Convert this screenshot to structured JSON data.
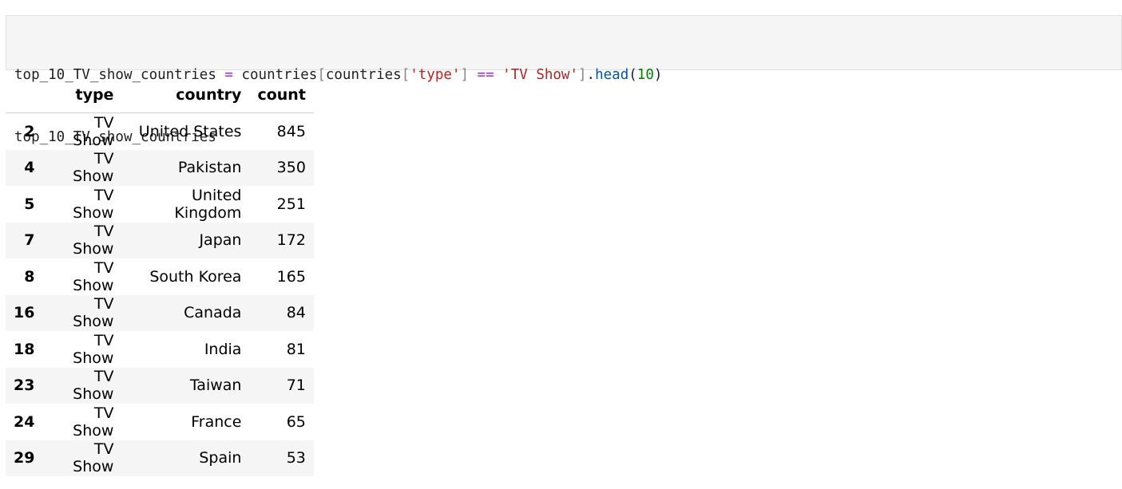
{
  "code_cell": {
    "line1": [
      {
        "t": "top_10_TV_show_countries ",
        "c": "var"
      },
      {
        "t": "=",
        "c": "op"
      },
      {
        "t": " countries",
        "c": "var"
      },
      {
        "t": "[",
        "c": "br"
      },
      {
        "t": "countries",
        "c": "var"
      },
      {
        "t": "[",
        "c": "br"
      },
      {
        "t": "'type'",
        "c": "str"
      },
      {
        "t": "]",
        "c": "br"
      },
      {
        "t": " ",
        "c": "p"
      },
      {
        "t": "==",
        "c": "op"
      },
      {
        "t": " ",
        "c": "p"
      },
      {
        "t": "'TV Show'",
        "c": "str"
      },
      {
        "t": "]",
        "c": "br"
      },
      {
        "t": ".",
        "c": "p"
      },
      {
        "t": "head",
        "c": "fn"
      },
      {
        "t": "(",
        "c": "p"
      },
      {
        "t": "10",
        "c": "num"
      },
      {
        "t": ")",
        "c": "p"
      }
    ],
    "line2": "top_10_TV_show_countries"
  },
  "dataframe": {
    "columns": [
      "",
      "type",
      "country",
      "count"
    ],
    "rows": [
      {
        "index": "2",
        "type": "TV Show",
        "country": "United States",
        "count": "845"
      },
      {
        "index": "4",
        "type": "TV Show",
        "country": "Pakistan",
        "count": "350"
      },
      {
        "index": "5",
        "type": "TV Show",
        "country": "United Kingdom",
        "count": "251"
      },
      {
        "index": "7",
        "type": "TV Show",
        "country": "Japan",
        "count": "172"
      },
      {
        "index": "8",
        "type": "TV Show",
        "country": "South Korea",
        "count": "165"
      },
      {
        "index": "16",
        "type": "TV Show",
        "country": "Canada",
        "count": "84"
      },
      {
        "index": "18",
        "type": "TV Show",
        "country": "India",
        "count": "81"
      },
      {
        "index": "23",
        "type": "TV Show",
        "country": "Taiwan",
        "count": "71"
      },
      {
        "index": "24",
        "type": "TV Show",
        "country": "France",
        "count": "65"
      },
      {
        "index": "29",
        "type": "TV Show",
        "country": "Spain",
        "count": "53"
      }
    ]
  }
}
